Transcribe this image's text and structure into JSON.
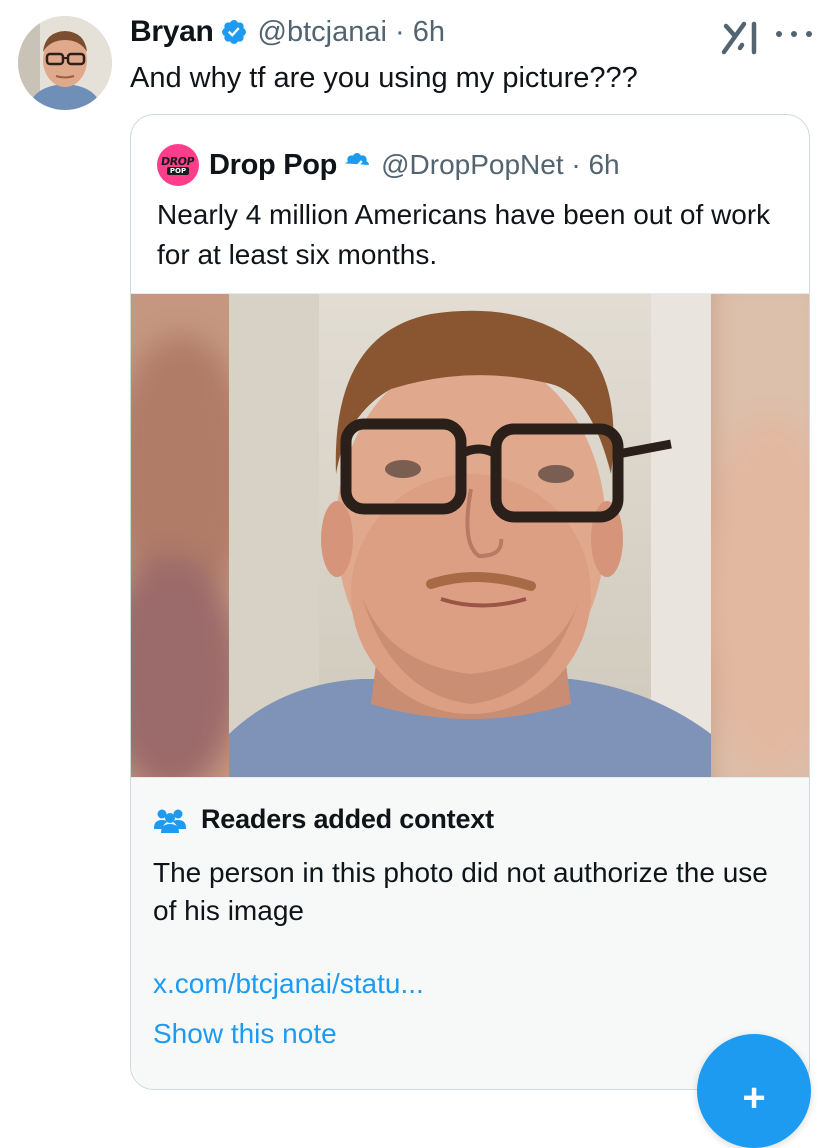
{
  "tweet": {
    "author_name": "Bryan",
    "author_handle": "@btcjanai · 6h",
    "text": "And why tf are you using my picture???"
  },
  "quoted_tweet": {
    "logo_line1": "DROP",
    "logo_line2": "POP",
    "author_name": "Drop Pop",
    "author_handle": "@DropPopNet · 6h",
    "text": "Nearly 4 million Americans have been out of work for at least six months."
  },
  "community_note": {
    "title": "Readers added context",
    "body": "The person in this photo did not authorize the use of his image",
    "link": "x.com/btcjanai/statu...",
    "show_label": "Show this note"
  },
  "fab": {
    "label": "+"
  },
  "icons": {
    "verified": "verified-badge-icon",
    "grok": "grok-icon",
    "more": "more-options-icon",
    "people": "community-notes-icon"
  },
  "colors": {
    "accent": "#1d9bf0",
    "text": "#0f1419",
    "secondary": "#536471",
    "border": "#cfd9de",
    "note_bg": "#f7f9f9",
    "brand_pink": "#ff3d8b"
  }
}
